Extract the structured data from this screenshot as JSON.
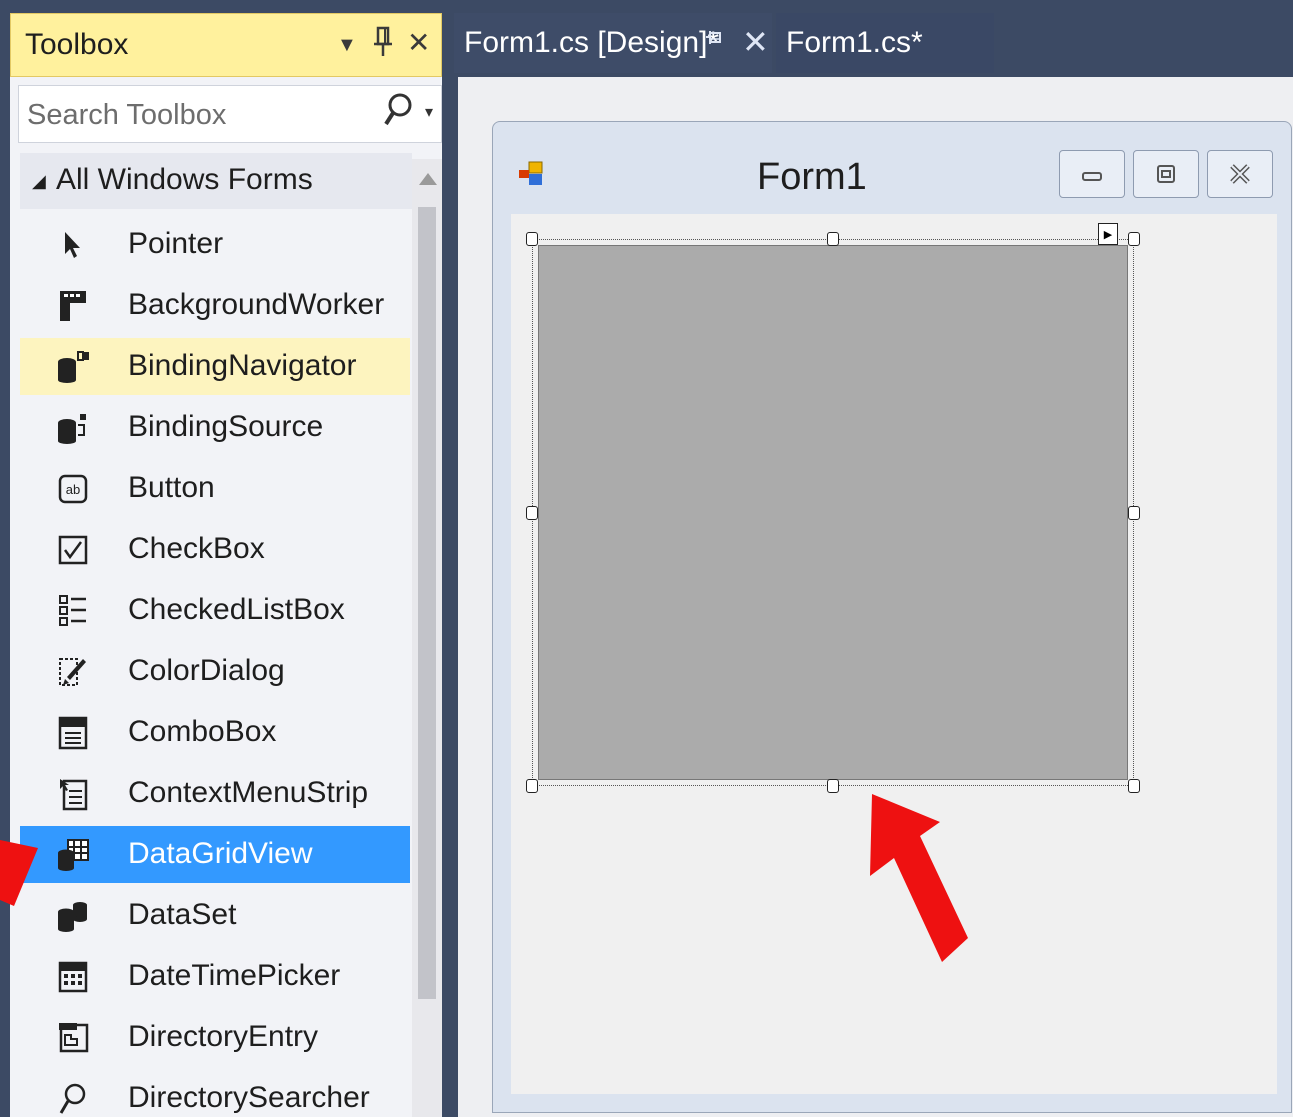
{
  "toolbox": {
    "title": "Toolbox",
    "search_placeholder": "Search Toolbox",
    "group": "All Windows Forms",
    "items": [
      {
        "label": "Pointer",
        "icon": "pointer-icon",
        "state": "normal"
      },
      {
        "label": "BackgroundWorker",
        "icon": "background-worker-icon",
        "state": "normal"
      },
      {
        "label": "BindingNavigator",
        "icon": "binding-navigator-icon",
        "state": "hover"
      },
      {
        "label": "BindingSource",
        "icon": "binding-source-icon",
        "state": "normal"
      },
      {
        "label": "Button",
        "icon": "button-icon",
        "state": "normal"
      },
      {
        "label": "CheckBox",
        "icon": "checkbox-icon",
        "state": "normal"
      },
      {
        "label": "CheckedListBox",
        "icon": "checked-list-box-icon",
        "state": "normal"
      },
      {
        "label": "ColorDialog",
        "icon": "color-dialog-icon",
        "state": "normal"
      },
      {
        "label": "ComboBox",
        "icon": "combo-box-icon",
        "state": "normal"
      },
      {
        "label": "ContextMenuStrip",
        "icon": "context-menu-strip-icon",
        "state": "normal"
      },
      {
        "label": "DataGridView",
        "icon": "data-grid-view-icon",
        "state": "selected"
      },
      {
        "label": "DataSet",
        "icon": "data-set-icon",
        "state": "normal"
      },
      {
        "label": "DateTimePicker",
        "icon": "date-time-picker-icon",
        "state": "normal"
      },
      {
        "label": "DirectoryEntry",
        "icon": "directory-entry-icon",
        "state": "normal"
      },
      {
        "label": "DirectorySearcher",
        "icon": "directory-searcher-icon",
        "state": "normal"
      }
    ]
  },
  "tabs": {
    "design": "Form1.cs [Design]*",
    "code": "Form1.cs*"
  },
  "form": {
    "title": "Form1"
  },
  "colors": {
    "ide_frame": "#3c4a64",
    "toolbox_title": "#fff19d",
    "hover": "#fdf4bf",
    "selected": "#3399ff",
    "grid_control": "#ababab",
    "annotation_arrow": "#ee1111"
  }
}
